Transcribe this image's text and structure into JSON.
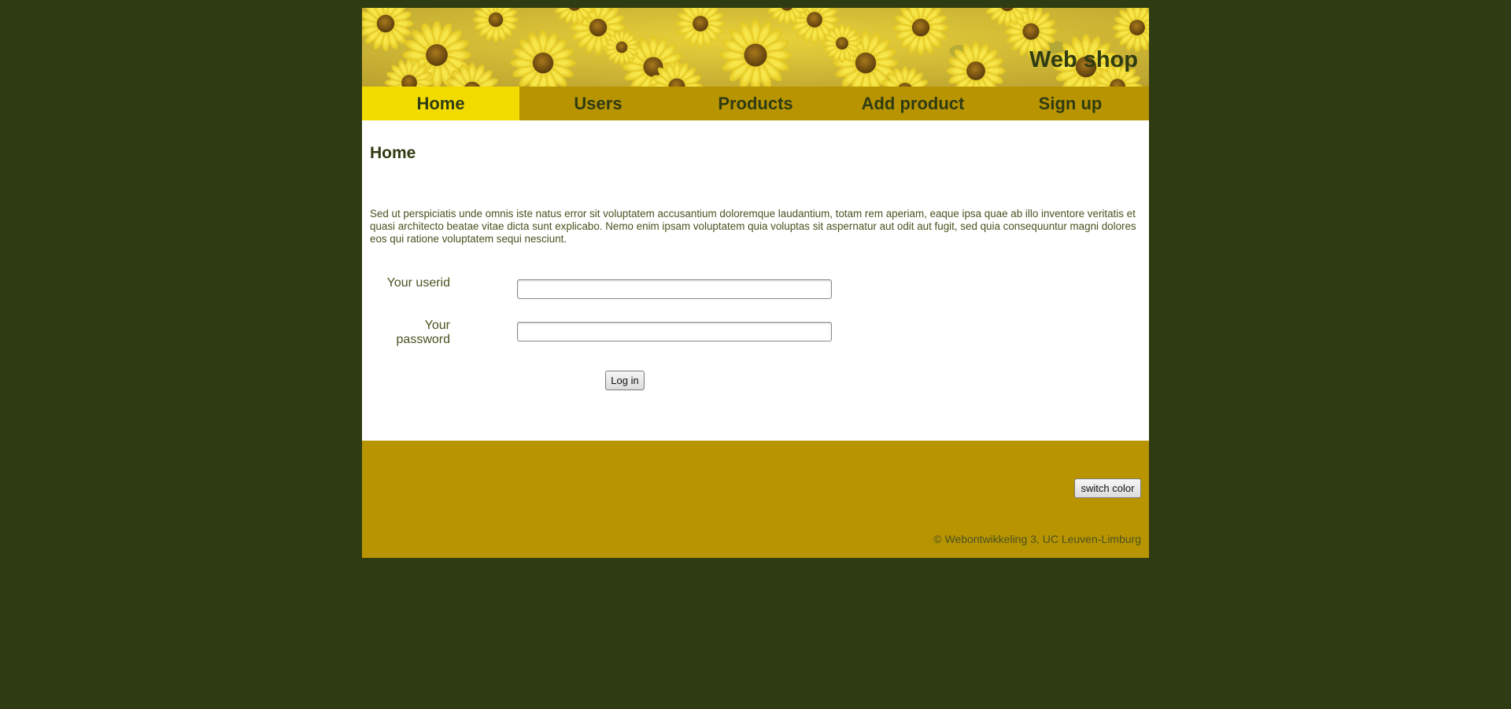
{
  "header": {
    "title": "Web shop"
  },
  "nav": {
    "items": [
      {
        "label": "Home",
        "active": true
      },
      {
        "label": "Users",
        "active": false
      },
      {
        "label": "Products",
        "active": false
      },
      {
        "label": "Add product",
        "active": false
      },
      {
        "label": "Sign up",
        "active": false
      }
    ]
  },
  "main": {
    "heading": "Home",
    "intro": "Sed ut perspiciatis unde omnis iste natus error sit voluptatem accusantium doloremque laudantium, totam rem aperiam, eaque ipsa quae ab illo inventore veritatis et quasi architecto beatae vitae dicta sunt explicabo. Nemo enim ipsam voluptatem quia voluptas sit aspernatur aut odit aut fugit, sed quia consequuntur magni dolores eos qui ratione voluptatem sequi nesciunt.",
    "form": {
      "userid_label": "Your userid",
      "userid_value": "",
      "password_label": "Your password",
      "password_value": "",
      "login_label": "Log in"
    }
  },
  "footer": {
    "switch_color_label": "switch color",
    "copyright": "© Webontwikkeling 3, UC Leuven-Limburg"
  },
  "colors": {
    "page_background": "#2f3b12",
    "nav_background": "#b89400",
    "nav_active": "#f2dc00",
    "text_dark": "#2f3b12",
    "footer_background": "#b89400"
  }
}
